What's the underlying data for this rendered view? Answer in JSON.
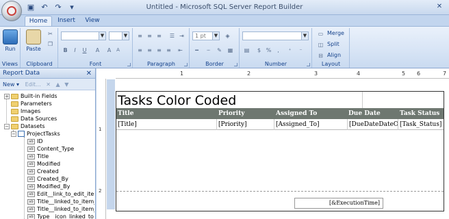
{
  "window": {
    "title": "Untitled - Microsoft SQL Server Report Builder"
  },
  "tabs": [
    {
      "label": "Home",
      "active": true
    },
    {
      "label": "Insert",
      "active": false
    },
    {
      "label": "View",
      "active": false
    }
  ],
  "ribbon": {
    "groups": {
      "views": "Views",
      "clipboard": "Clipboard",
      "font": "Font",
      "paragraph": "Paragraph",
      "border": "Border",
      "number": "Number",
      "layout": "Layout"
    },
    "run_label": "Run",
    "paste_label": "Paste",
    "border_width": "1 pt",
    "merge_label": "Merge",
    "split_label": "Split",
    "align_label": "Align"
  },
  "report_data": {
    "title": "Report Data",
    "new_label": "New",
    "edit_label": "Edit...",
    "tree": {
      "builtin": "Built-in Fields",
      "parameters": "Parameters",
      "images": "Images",
      "data_sources": "Data Sources",
      "datasets": "Datasets",
      "dataset_name": "ProjectTasks",
      "fields": [
        "ID",
        "Content_Type",
        "Title",
        "Modified",
        "Created",
        "Created_By",
        "Modified_By",
        "Edit__link_to_edit_item_",
        "Title__linked_to_item_",
        "Title__linked_to_item_w",
        "Type__icon_linked_to_d"
      ]
    }
  },
  "ruler": {
    "top_numbers": [
      "1",
      "2",
      "3",
      "4",
      "5",
      "6",
      "7"
    ],
    "left_numbers": [
      "1",
      "2"
    ]
  },
  "report": {
    "title": "Tasks Color Coded",
    "columns": [
      "Title",
      "Priority",
      "Assigned To",
      "Due Date",
      "Task Status"
    ],
    "row": [
      "[Title]",
      "[Priority]",
      "[Assigned_To]",
      "[DueDateDateOn",
      "[Task_Status]"
    ],
    "footer": "[&ExecutionTime]"
  },
  "colors": {
    "header_bg": "#6e7770",
    "ribbon_accent": "#15428b"
  }
}
